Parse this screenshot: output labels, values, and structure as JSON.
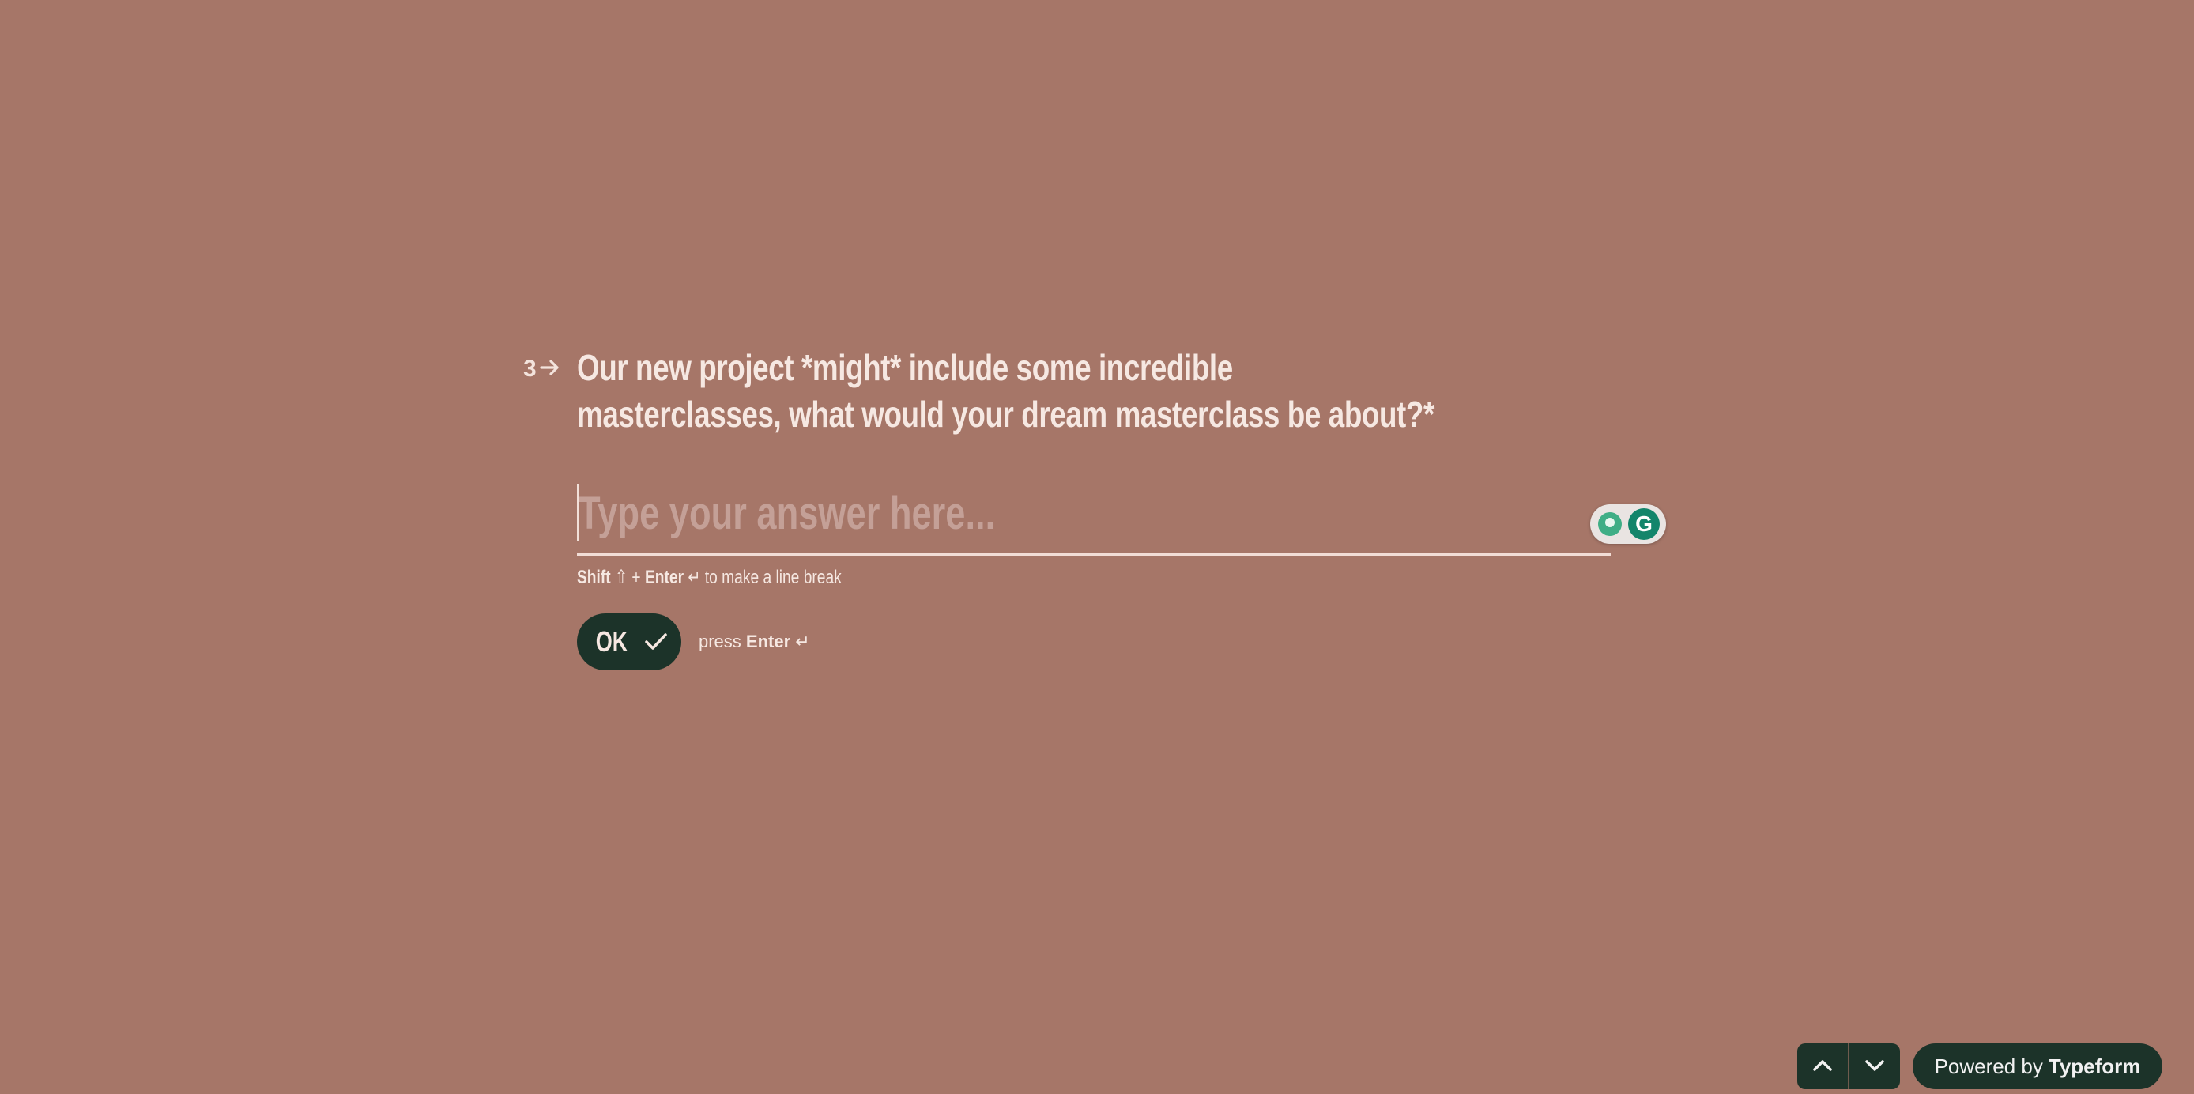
{
  "question": {
    "number": "3",
    "text": "Our new project *might* include some incredible masterclasses, what would your dream masterclass be about?*"
  },
  "answer": {
    "placeholder": "Type your answer here...",
    "value": ""
  },
  "hint": {
    "shift": "Shift",
    "plus": "+",
    "enter": "Enter",
    "rest": "to make a line break"
  },
  "ok_button": {
    "label": "OK"
  },
  "press_hint": {
    "press": "press",
    "enter": "Enter"
  },
  "footer": {
    "powered_prefix": "Powered by",
    "powered_brand": "Typeform"
  },
  "colors": {
    "background": "#a67668",
    "button": "#1c3329",
    "text": "#f6e8e2"
  },
  "icons": {
    "question_arrow": "arrow-right-icon",
    "ok_check": "check-icon",
    "nav_up": "chevron-up-icon",
    "nav_down": "chevron-down-icon",
    "grammarly_assist": "lightbulb-icon",
    "grammarly_logo": "grammarly-icon"
  }
}
